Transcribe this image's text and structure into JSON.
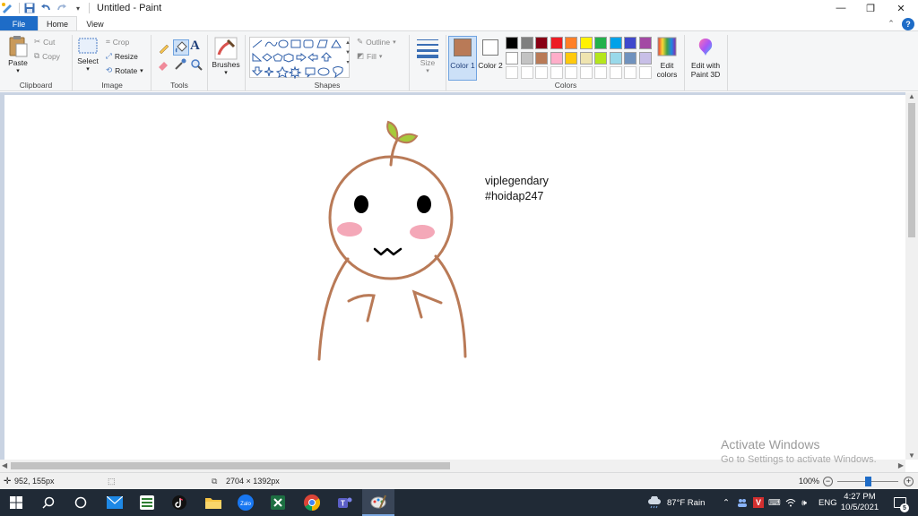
{
  "window": {
    "title": "Untitled - Paint",
    "minimize_glyph": "—",
    "restore_glyph": "❐",
    "close_glyph": "✕"
  },
  "tabs": {
    "file": "File",
    "home": "Home",
    "view": "View"
  },
  "help_glyph": "?",
  "ribbon": {
    "clipboard": {
      "label": "Clipboard",
      "paste": "Paste",
      "cut": "Cut",
      "copy": "Copy"
    },
    "image": {
      "label": "Image",
      "select": "Select",
      "crop": "Crop",
      "resize": "Resize",
      "rotate": "Rotate"
    },
    "tools": {
      "label": "Tools"
    },
    "brushes": {
      "label": "Brushes"
    },
    "shapes": {
      "label": "Shapes",
      "outline": "Outline",
      "fill": "Fill"
    },
    "size": {
      "label": "Size"
    },
    "colors": {
      "label": "Colors",
      "color1": "Color 1",
      "color2": "Color 2",
      "color1_value": "#b97a57",
      "color2_value": "#ffffff",
      "edit_colors": "Edit colors",
      "palette_row1": [
        "#000000",
        "#7f7f7f",
        "#880015",
        "#ed1c24",
        "#ff7f27",
        "#fff200",
        "#22b14c",
        "#00a2e8",
        "#3f48cc",
        "#a349a4"
      ],
      "palette_row2": [
        "#ffffff",
        "#c3c3c3",
        "#b97a57",
        "#ffaec9",
        "#ffc90e",
        "#efe4b0",
        "#b5e61d",
        "#99d9ea",
        "#7092be",
        "#c8bfe7"
      ]
    },
    "paint3d": "Edit with Paint 3D"
  },
  "canvas": {
    "text_line1": "viplegendary",
    "text_line2": "#hoidap247"
  },
  "watermark": {
    "title": "Activate Windows",
    "subtitle": "Go to Settings to activate Windows."
  },
  "status": {
    "cursor_pos": "952, 155px",
    "image_size": "2704 × 1392px",
    "zoom": "100%"
  },
  "taskbar": {
    "weather": "87°F  Rain",
    "language": "ENG",
    "time": "4:27 PM",
    "date": "10/5/2021",
    "notification_count": "5"
  }
}
